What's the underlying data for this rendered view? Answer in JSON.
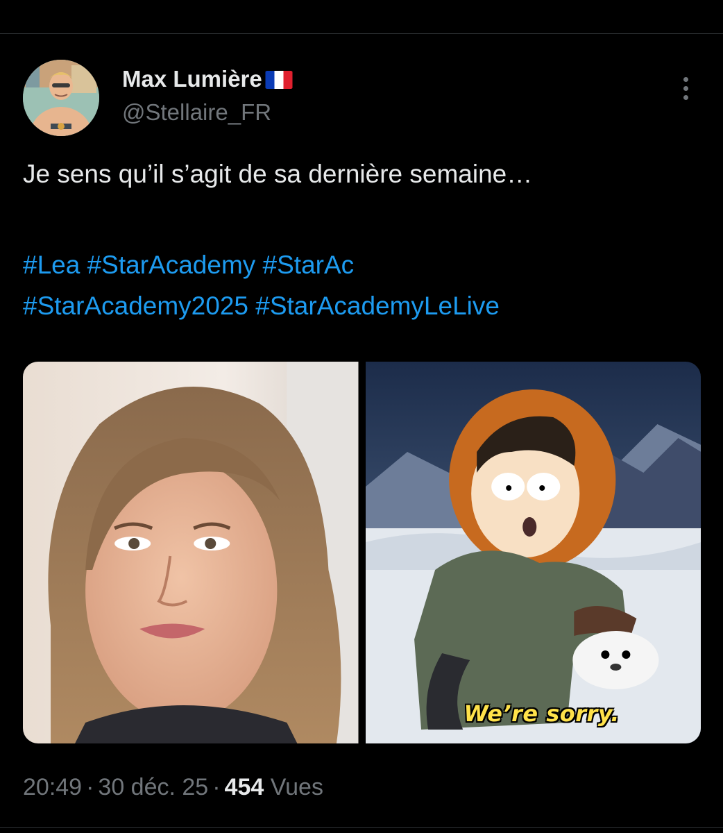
{
  "tweet": {
    "author": {
      "display_name": "Max Lumière",
      "flag": "france-flag",
      "handle": "@Stellaire_FR",
      "avatar": "illustrated-avatar"
    },
    "text": "Je sens qu’il s’agit de sa dernière semaine…",
    "hashtags": [
      "#Lea",
      "#StarAcademy",
      "#StarAc",
      "#StarAcademy2025",
      "#StarAcademyLeLive"
    ],
    "media": [
      {
        "alt_icon": "photo-woman-portrait"
      },
      {
        "alt_icon": "cartoon-still",
        "caption": "We’re sorry."
      }
    ],
    "meta": {
      "time": "20:49",
      "separator": "·",
      "date": "30 déc. 25",
      "views_count": "454",
      "views_label": "Vues"
    }
  },
  "colors": {
    "background": "#000000",
    "text": "#e7e9ea",
    "secondary_text": "#71767b",
    "link": "#1d9bf0",
    "divider": "#2f3336"
  }
}
